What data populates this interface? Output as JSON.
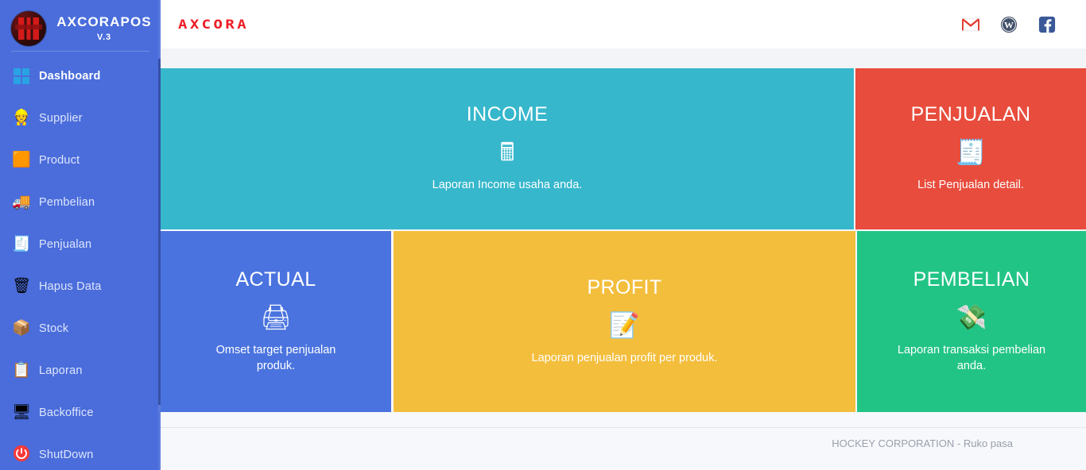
{
  "sidebar": {
    "brand": {
      "name": "AXCORAPOS",
      "version": "V.3",
      "logo_icon": "app-logo"
    },
    "items": [
      {
        "label": "Dashboard",
        "icon": "windows-icon",
        "glyph": "",
        "active": true
      },
      {
        "label": "Supplier",
        "icon": "supplier-icon",
        "glyph": "👷",
        "active": false
      },
      {
        "label": "Product",
        "icon": "product-box-icon",
        "glyph": "🟧",
        "active": false
      },
      {
        "label": "Pembelian",
        "icon": "delivery-truck-icon",
        "glyph": "🚚",
        "active": false
      },
      {
        "label": "Penjualan",
        "icon": "cash-register-icon",
        "glyph": "🧾",
        "active": false
      },
      {
        "label": "Hapus Data",
        "icon": "trash-icon",
        "glyph": "🗑",
        "active": false
      },
      {
        "label": "Stock",
        "icon": "package-icon",
        "glyph": "📦",
        "active": false
      },
      {
        "label": "Laporan",
        "icon": "clipboard-icon",
        "glyph": "📋",
        "active": false
      },
      {
        "label": "Backoffice",
        "icon": "monitor-icon",
        "glyph": "🖥",
        "active": false
      },
      {
        "label": "ShutDown",
        "icon": "power-icon",
        "glyph": "⏻",
        "active": false
      }
    ]
  },
  "topbar": {
    "logo_text": "AXCORA",
    "logo_color": "#ee1c25",
    "icons": [
      {
        "name": "gmail-icon",
        "label": "Gmail"
      },
      {
        "name": "wordpress-icon",
        "label": "WordPress"
      },
      {
        "name": "facebook-icon",
        "label": "Facebook"
      }
    ]
  },
  "tiles": [
    {
      "title": "INCOME",
      "desc": "Laporan Income usaha anda.",
      "icon": "pos-terminal-icon",
      "glyph": "🖩",
      "color": "#36b7cc"
    },
    {
      "title": "PENJUALAN",
      "desc": "List Penjualan detail.",
      "icon": "cash-register-icon",
      "glyph": "🧾",
      "color": "#e84c3c"
    },
    {
      "title": "ACTUAL",
      "desc": "Omset target penjualan produk.",
      "icon": "receipt-printer-icon",
      "glyph": "🖨",
      "color": "#4a73df"
    },
    {
      "title": "PROFIT",
      "desc": "Laporan penjualan profit per produk.",
      "icon": "memo-icon",
      "glyph": "📝",
      "color": "#f3be3c"
    },
    {
      "title": "PEMBELIAN",
      "desc": "Laporan transaksi pembelian anda.",
      "icon": "money-hand-icon",
      "glyph": "💸",
      "color": "#22c486"
    }
  ],
  "footer": {
    "text": "HOCKEY CORPORATION - Ruko pasa"
  }
}
